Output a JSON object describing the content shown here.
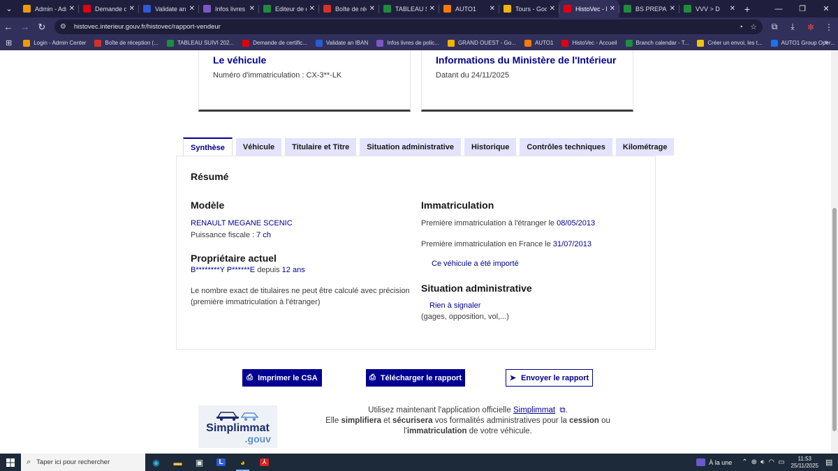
{
  "browser": {
    "tabs": [
      {
        "title": "Admin - Adm",
        "color": "#f29900",
        "active": false
      },
      {
        "title": "Demande de",
        "color": "#e1000f",
        "active": false
      },
      {
        "title": "Validate an I",
        "color": "#2b5bd7",
        "active": false
      },
      {
        "title": "Infos livres d",
        "color": "#7e57c2",
        "active": false
      },
      {
        "title": "Editeur de d",
        "color": "#1e8e3e",
        "active": false
      },
      {
        "title": "Boîte de réc",
        "color": "#d93025",
        "active": false
      },
      {
        "title": "TABLEAU SU",
        "color": "#1e8e3e",
        "active": false
      },
      {
        "title": "AUTO1",
        "color": "#ff7a00",
        "active": false
      },
      {
        "title": "Tours - Goo",
        "color": "#f4b400",
        "active": false
      },
      {
        "title": "HistoVec - R",
        "color": "#e1000f",
        "active": true
      },
      {
        "title": "BS PREPA VC",
        "color": "#1e8e3e",
        "active": false
      },
      {
        "title": "VVV > D",
        "color": "#1e8e3e",
        "active": false
      }
    ],
    "url": "histovec.interieur.gouv.fr/histovec/rapport-vendeur",
    "bookmarks": [
      {
        "title": "Login - Admin Center",
        "color": "#f29900"
      },
      {
        "title": "Boîte de réception (...",
        "color": "#d93025"
      },
      {
        "title": "TABLEAU SUIVI 202...",
        "color": "#1e8e3e"
      },
      {
        "title": "Demande de certific...",
        "color": "#e1000f"
      },
      {
        "title": "Validate an IBAN",
        "color": "#2b5bd7"
      },
      {
        "title": "Infos livres de polic...",
        "color": "#7e57c2"
      },
      {
        "title": "GRAND OUEST - Go...",
        "color": "#f4b400"
      },
      {
        "title": "AUTO1",
        "color": "#ff7a00"
      },
      {
        "title": "HistoVec - Accueil",
        "color": "#e1000f"
      },
      {
        "title": "Branch calendar - T...",
        "color": "#1e8e3e"
      },
      {
        "title": "Créer un envoi, les t...",
        "color": "#f2c500"
      },
      {
        "title": "AUTO1 Group Oper...",
        "color": "#1a73e8"
      }
    ]
  },
  "page": {
    "card_vehicle": {
      "title": "Le véhicule",
      "plate": "Numéro d'immatriculation : CX-3**-LK"
    },
    "card_ministry": {
      "title": "Informations du Ministère de l'Intérieur",
      "date": "Datant du 24/11/2025"
    },
    "tabs": [
      "Synthèse",
      "Véhicule",
      "Titulaire et Titre",
      "Situation administrative",
      "Historique",
      "Contrôles techniques",
      "Kilométrage"
    ],
    "summary": {
      "heading": "Résumé",
      "model": {
        "heading": "Modèle",
        "name": "RENAULT MEGANE SCENIC",
        "power_label": "Puissance fiscale : ",
        "power_value": "7 ch"
      },
      "owner": {
        "heading": "Propriétaire actuel",
        "name": "B********Y P******E",
        "since_label": " depuis ",
        "since_value": "12 ans",
        "note": "Le nombre exact de titulaires ne peut être calculé avec précision (première immatriculation à l'étranger)"
      },
      "registration": {
        "heading": "Immatriculation",
        "foreign_label": "Première immatriculation à l'étranger le ",
        "foreign_date": "08/05/2013",
        "france_label": "Première immatriculation en France le ",
        "france_date": "31/07/2013",
        "imported": "Ce véhicule a été importé"
      },
      "admin": {
        "heading": "Situation administrative",
        "status": "Rien à signaler",
        "detail": "(gages, opposition, vol,...)"
      }
    },
    "buttons": {
      "print": "Imprimer le CSA",
      "download": "Télécharger le rapport",
      "send": "Envoyer le rapport"
    },
    "promo": {
      "logo_main": "Simplimmat",
      "logo_sub": ".gouv",
      "line1_pre": "Utilisez maintenant l'application officielle ",
      "link": "Simplimmat",
      "line2_pre": "Elle ",
      "b1": "simplifiera",
      "mid1": " et ",
      "b2": "sécurisera",
      "mid2": " vos formalités administratives pour la ",
      "b3": "cession",
      "mid3": " ou l'",
      "b4": "immatriculation",
      "line2_post": " de votre véhicule."
    }
  },
  "taskbar": {
    "search_placeholder": "Taper ici pour rechercher",
    "news": "À la une",
    "time": "11:53",
    "date": "25/11/2025"
  }
}
